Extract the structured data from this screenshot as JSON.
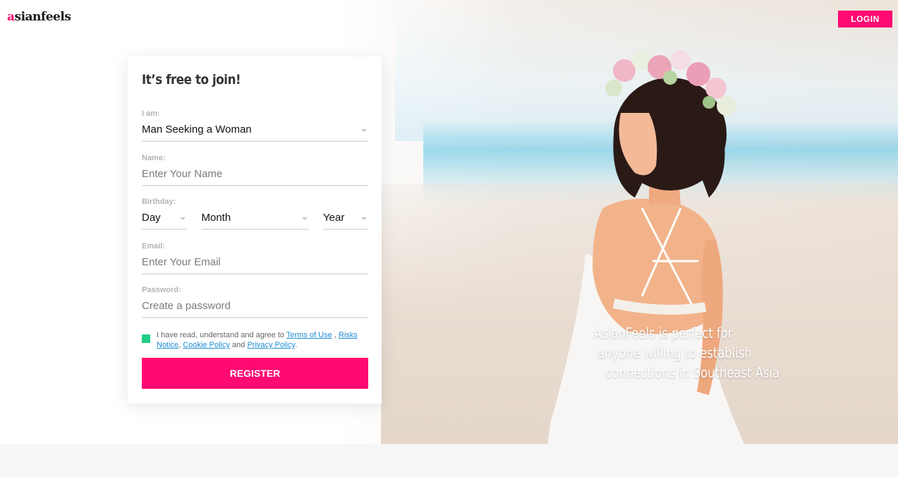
{
  "brand": {
    "logo_prefix": "a",
    "logo_rest": "sianfeels",
    "accent": "#ff0a73"
  },
  "header": {
    "login_label": "LOGIN"
  },
  "form": {
    "title": "It’s free to join!",
    "iam": {
      "label": "I am:",
      "value": "Man Seeking a Woman"
    },
    "name": {
      "label": "Name:",
      "placeholder": "Enter Your Name"
    },
    "birthday": {
      "label": "Birthday:",
      "day": "Day",
      "month": "Month",
      "year": "Year"
    },
    "email": {
      "label": "Email:",
      "placeholder": "Enter Your Email"
    },
    "password": {
      "label": "Password:",
      "placeholder": "Create a password"
    },
    "terms": {
      "text_before": "I have read, understand and agree to",
      "terms_link": "Terms of Use",
      "sep1": ",",
      "risks_link": "Risks Notice",
      "sep2": ",",
      "cookie_link": "Cookie Policy",
      "and": "and",
      "privacy_link": "Privacy Policy",
      "end": "."
    },
    "register_label": "REGISTER"
  },
  "hero": {
    "tagline_lines": [
      "AsianFeels is perfect for",
      "anyone willing to establish",
      "connections in Southeast Asia"
    ]
  }
}
